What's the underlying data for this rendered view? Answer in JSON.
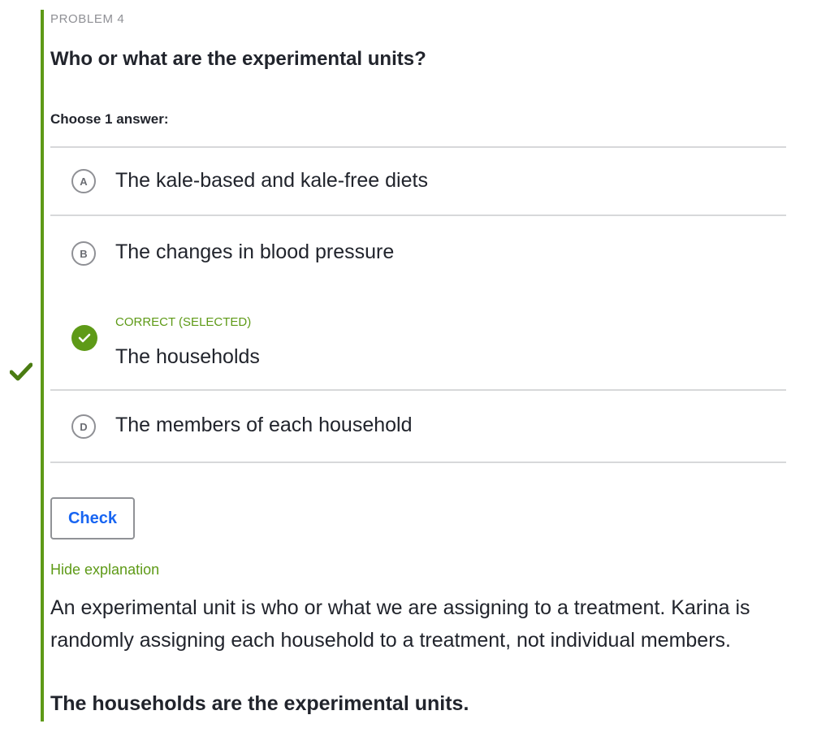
{
  "problem": {
    "label": "PROBLEM 4",
    "question": "Who or what are the experimental units?",
    "instruction": "Choose 1 answer:"
  },
  "choices": [
    {
      "letter": "A",
      "text": "The kale-based and kale-free diets"
    },
    {
      "letter": "B",
      "text": "The changes in blood pressure"
    },
    {
      "letter": "C",
      "status": "CORRECT (SELECTED)",
      "text": "The households"
    },
    {
      "letter": "D",
      "text": "The members of each household"
    }
  ],
  "check_button": {
    "label": "Check"
  },
  "explanation": {
    "toggle_label": "Hide explanation",
    "body": "An experimental unit is who or what we are assigning to a treatment. Karina is randomly assigning each household to a treatment, not individual members.",
    "conclusion": "The households are the experimental units."
  },
  "colors": {
    "correct_green": "#5e9a17",
    "link_blue": "#1865f2",
    "text_dark": "#21242c",
    "text_muted": "#8f9095",
    "divider_gray": "#d7d8da"
  },
  "icons": {
    "left_status": "checkmark-icon",
    "selected_choice": "check-circle-icon"
  }
}
